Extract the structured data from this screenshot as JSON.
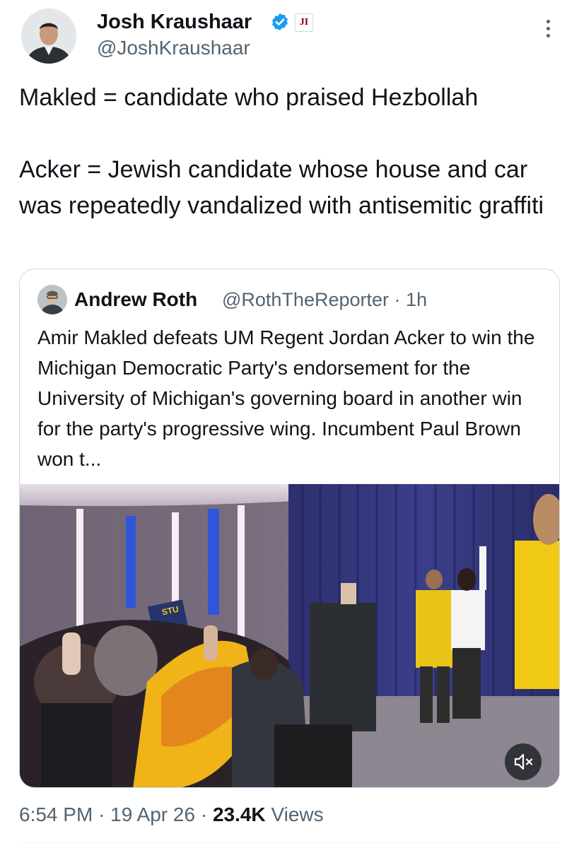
{
  "author": {
    "name": "Josh Kraushaar",
    "handle": "@JoshKraushaar",
    "affiliation_badge": "JI",
    "verified_color": "#1d9bf0"
  },
  "tweet": {
    "paragraphs": [
      "Makled = candidate who praised Hezbollah",
      "Acker = Jewish candidate whose house and car was repeatedly vandalized with antisemitic graffiti"
    ]
  },
  "quoted": {
    "name": "Andrew Roth",
    "handle": "@RothTheReporter",
    "time": "1h",
    "text": "Amir Makled defeats UM Regent Jordan Acker to win the Michigan Democratic Party's endorsement for the University of Michigan's governing board in another win for the party's progressive wing. Incumbent Paul Brown won t...",
    "media": {
      "type": "video",
      "sign_text": "STU",
      "mute_icon": "speaker-muted-icon"
    }
  },
  "footer": {
    "time": "6:54 PM",
    "date": "19 Apr 26",
    "views_count": "23.4K",
    "views_label": "Views"
  }
}
